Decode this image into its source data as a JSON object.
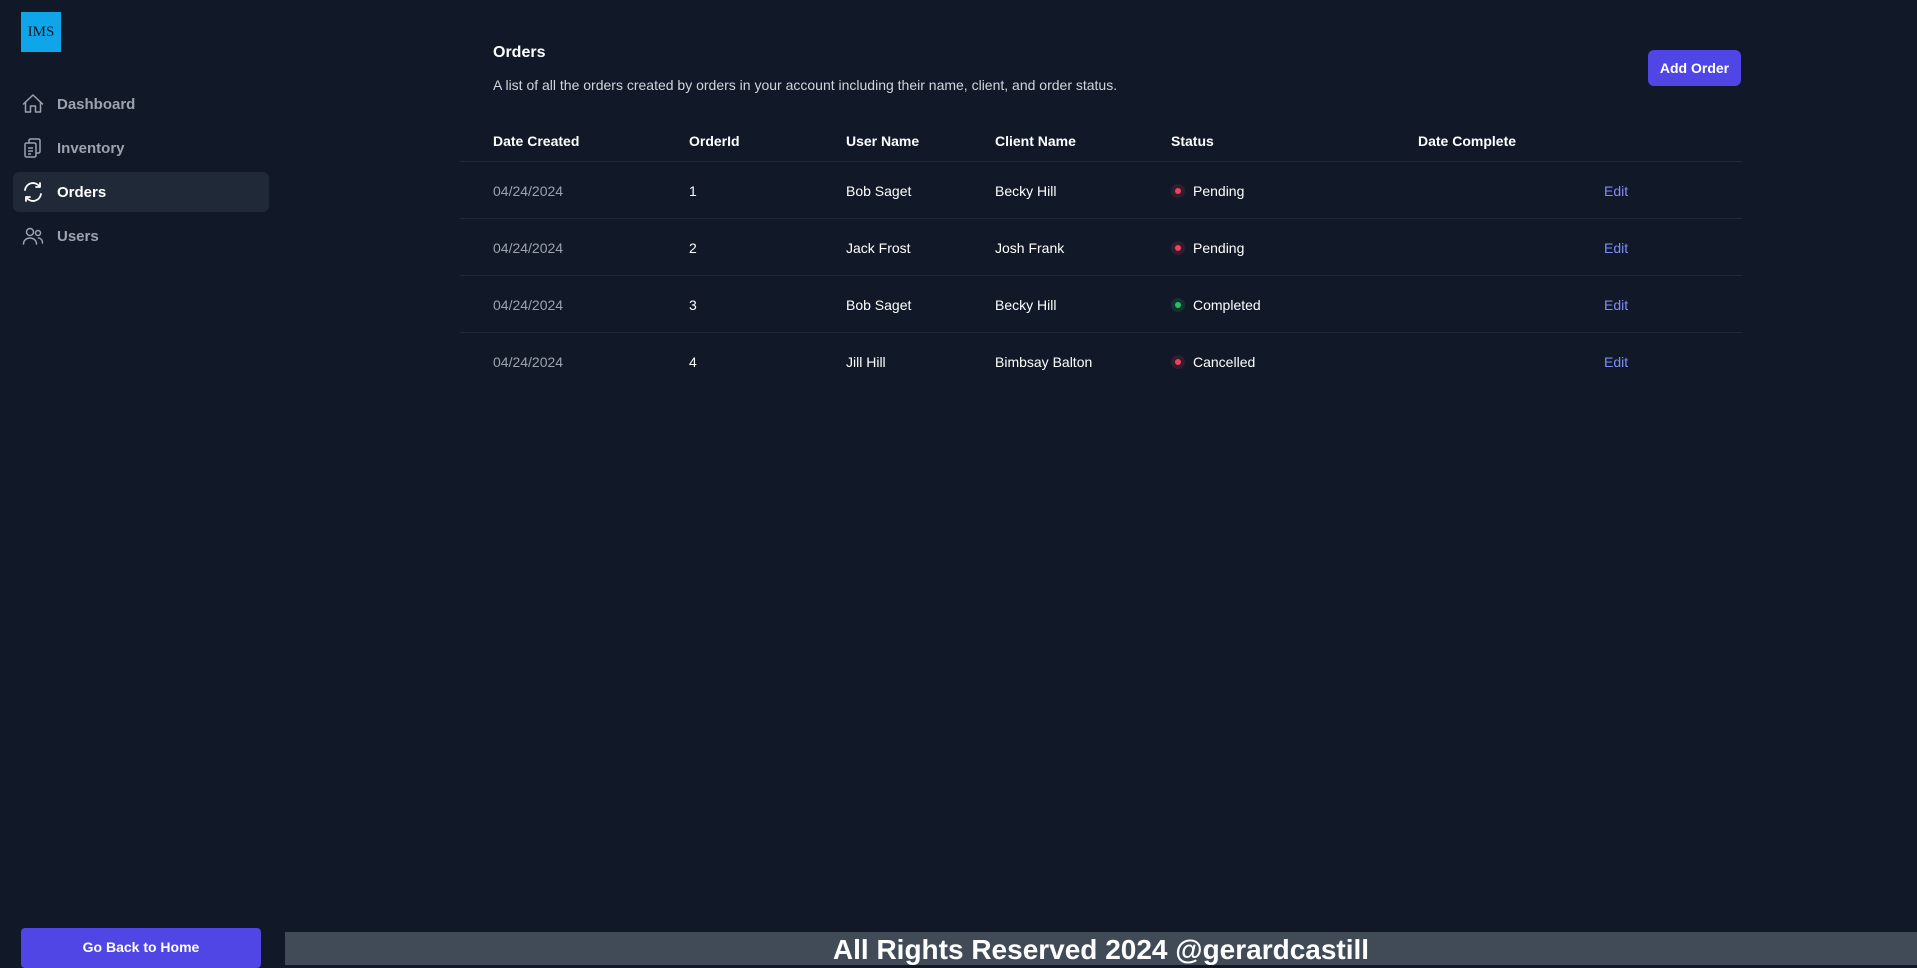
{
  "app": {
    "logo_text": "IMS"
  },
  "sidebar": {
    "items": [
      {
        "label": "Dashboard",
        "icon": "home-icon"
      },
      {
        "label": "Inventory",
        "icon": "documents-icon"
      },
      {
        "label": "Orders",
        "icon": "refresh-icon",
        "active": true
      },
      {
        "label": "Users",
        "icon": "users-icon"
      }
    ],
    "home_button": "Go Back to Home"
  },
  "main": {
    "title": "Orders",
    "description": "A list of all the orders created by orders in your account including their name, client, and order status.",
    "add_button": "Add Order"
  },
  "table": {
    "columns": [
      "Date Created",
      "OrderId",
      "User Name",
      "Client Name",
      "Status",
      "Date Complete"
    ],
    "rows": [
      {
        "date": "04/24/2024",
        "id": "1",
        "user": "Bob Saget",
        "client": "Becky Hill",
        "status": "Pending",
        "complete": "",
        "edit": "Edit"
      },
      {
        "date": "04/24/2024",
        "id": "2",
        "user": "Jack Frost",
        "client": "Josh Frank",
        "status": "Pending",
        "complete": "",
        "edit": "Edit"
      },
      {
        "date": "04/24/2024",
        "id": "3",
        "user": "Bob Saget",
        "client": "Becky Hill",
        "status": "Completed",
        "complete": "",
        "edit": "Edit"
      },
      {
        "date": "04/24/2024",
        "id": "4",
        "user": "Jill Hill",
        "client": "Bimbsay Balton",
        "status": "Cancelled",
        "complete": "",
        "edit": "Edit"
      }
    ]
  },
  "colors": {
    "background": "#111827",
    "accent": "#4f46e5",
    "logo": "#0ea5e9",
    "status_red": "#f43f5e",
    "status_green": "#22c55e"
  },
  "footer": {
    "text": "All Rights Reserved 2024 @gerardcastill"
  }
}
